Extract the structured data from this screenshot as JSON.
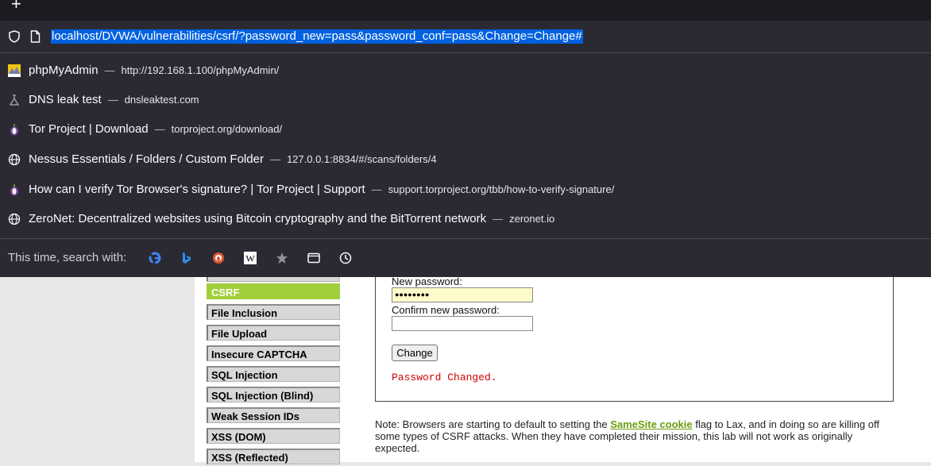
{
  "browser": {
    "new_tab_symbol": "+",
    "url": "localhost/DVWA/vulnerabilities/csrf/?password_new=pass&password_conf=pass&Change=Change#",
    "suggestions": [
      {
        "icon": "pma-favicon-icon",
        "title": "phpMyAdmin",
        "url": "http://192.168.1.100/phpMyAdmin/"
      },
      {
        "icon": "dnsleak-favicon-icon",
        "title": "DNS leak test",
        "url": "dnsleaktest.com"
      },
      {
        "icon": "tor-onion-icon",
        "title": "Tor Project | Download",
        "url": "torproject.org/download/"
      },
      {
        "icon": "globe-icon",
        "title": "Nessus Essentials / Folders / Custom Folder",
        "url": "127.0.0.1:8834/#/scans/folders/4"
      },
      {
        "icon": "tor-onion-icon",
        "title": "How can I verify Tor Browser's signature? | Tor Project | Support",
        "url": "support.torproject.org/tbb/how-to-verify-signature/"
      },
      {
        "icon": "globe-icon",
        "title": "ZeroNet: Decentralized websites using Bitcoin cryptography and the BitTorrent network",
        "url": "zeronet.io"
      }
    ],
    "dash": "—",
    "search_with_label": "This time, search with:",
    "search_engines": [
      "google-icon",
      "bing-icon",
      "duckduckgo-icon",
      "wikipedia-icon",
      "bookmarks-star-icon",
      "tabs-icon",
      "history-icon"
    ]
  },
  "menu": {
    "items": [
      "CSRF",
      "File Inclusion",
      "File Upload",
      "Insecure CAPTCHA",
      "SQL Injection",
      "SQL Injection (Blind)",
      "Weak Session IDs",
      "XSS (DOM)",
      "XSS (Reflected)"
    ],
    "active": "CSRF"
  },
  "form": {
    "new_password_label": "New password:",
    "new_password_value": "●●●●●●●●",
    "confirm_label": "Confirm new password:",
    "confirm_value": "",
    "button": "Change",
    "message": "Password Changed."
  },
  "note": {
    "before_link": "Note: Browsers are starting to default to setting the ",
    "link": "SameSite cookie",
    "after_link": " flag to Lax, and in doing so are killing off some types of CSRF attacks. When they have completed their mission, this lab will not work as originally expected."
  },
  "colors": {
    "active_menu": "#a1cf3b",
    "url_highlight": "#0061e0",
    "success_text": "#d00000"
  }
}
